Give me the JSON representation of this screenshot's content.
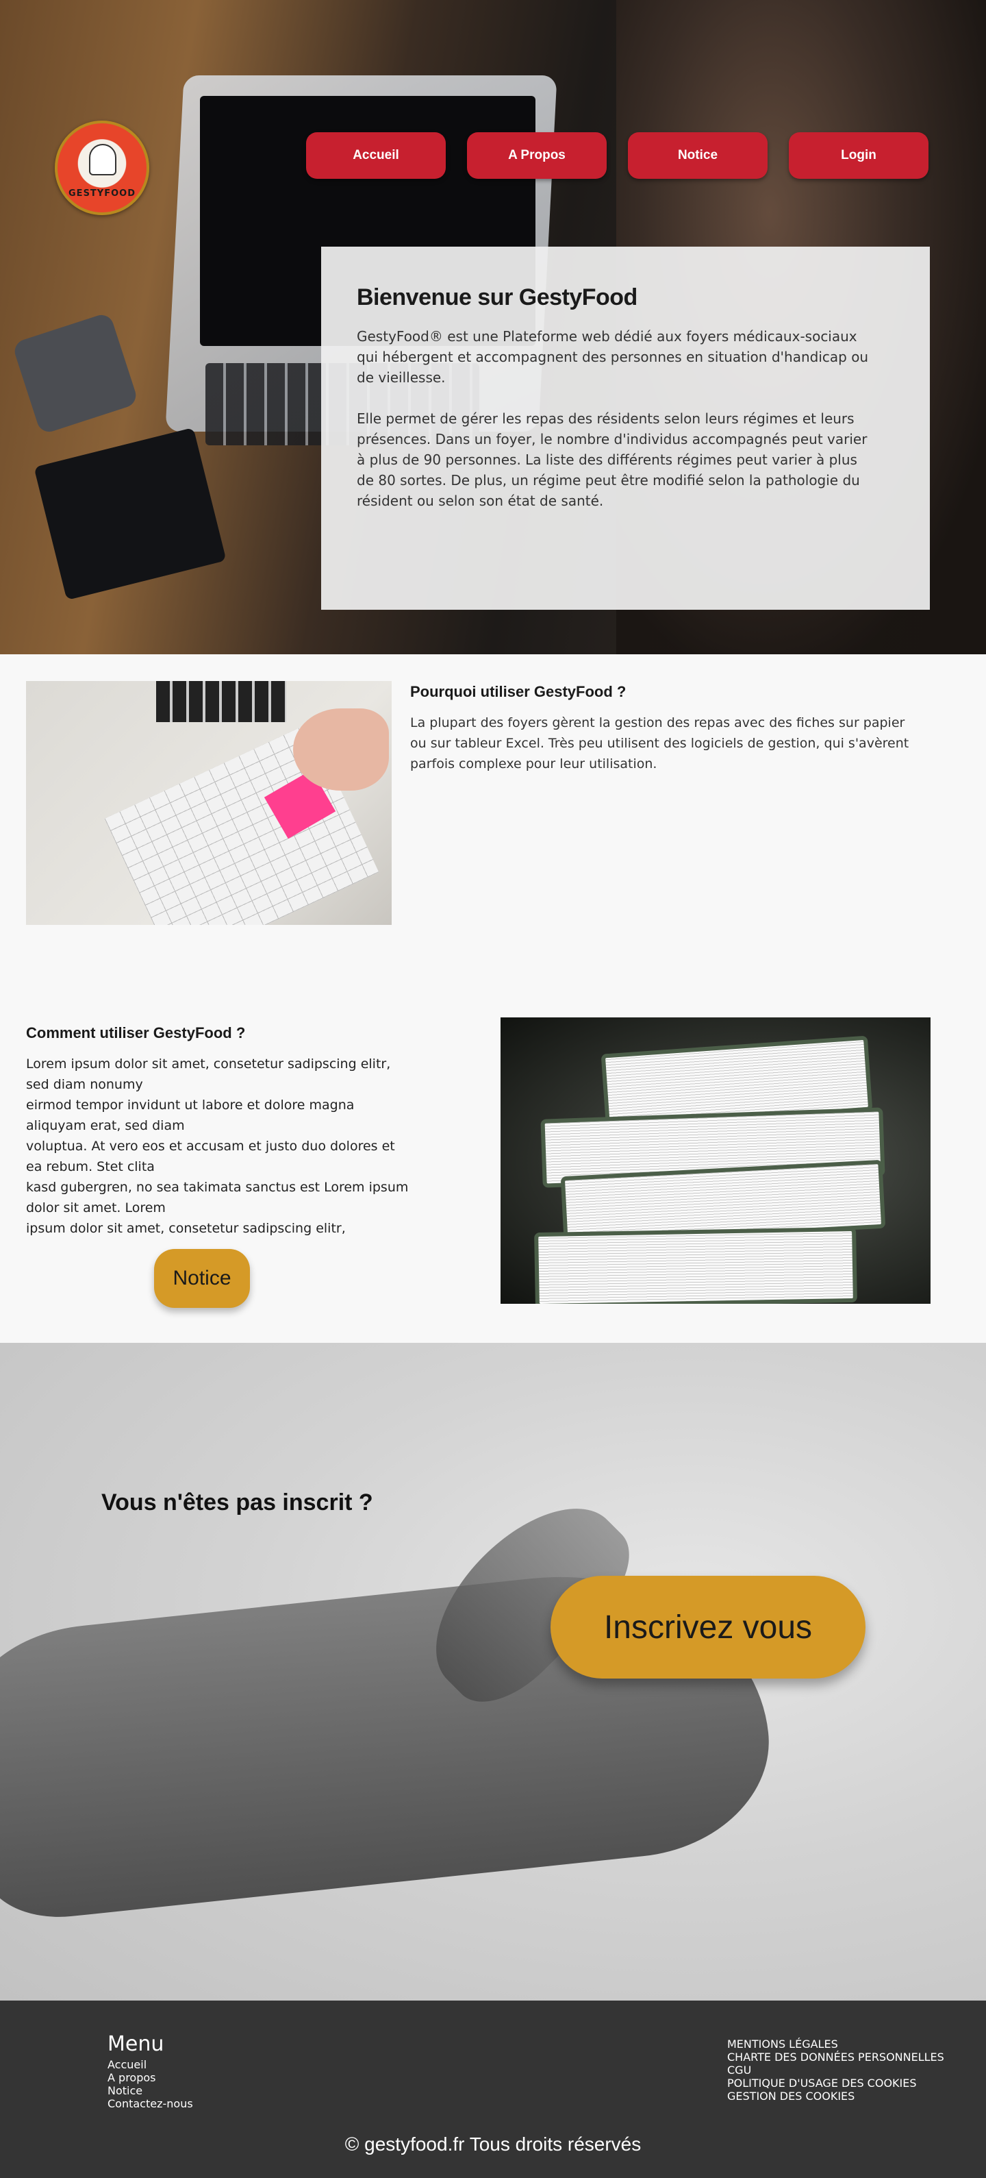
{
  "logo": {
    "text": "GESTYFOOD"
  },
  "nav": {
    "items": [
      "Accueil",
      "A Propos",
      "Notice",
      "Login"
    ]
  },
  "welcome": {
    "title": "Bienvenue sur GestyFood",
    "paragraph1": "GestyFood® est une Plateforme web dédié aux foyers médicaux-sociaux qui hébergent et accompagnent des personnes en situation d'handicap ou de vieillesse.",
    "paragraph2": "Elle permet de gérer les repas des résidents selon leurs régimes et leurs présences. Dans un foyer, le nombre d'individus accompagnés peut varier à plus de 90 personnes. La liste des différents régimes peut varier à plus de 80 sortes.  De plus, un régime peut être modifié selon la pathologie du résident ou selon son état de santé."
  },
  "why": {
    "title": "Pourquoi utiliser GestyFood ?",
    "text": "La plupart des foyers gèrent la gestion des repas avec des fiches sur papier ou sur tableur Excel. Très peu utilisent des logiciels  de gestion, qui s'avèrent parfois complexe pour leur utilisation."
  },
  "how": {
    "title": "Comment utiliser GestyFood ?",
    "text": "Lorem ipsum dolor sit amet, consetetur sadipscing elitr, sed diam nonumy\neirmod tempor invidunt ut labore et dolore magna aliquyam erat, sed diam\nvoluptua. At vero eos et accusam et justo duo dolores et ea rebum. Stet clita\nkasd gubergren, no sea takimata sanctus est Lorem ipsum dolor sit amet. Lorem\nipsum dolor sit amet, consetetur sadipscing elitr,",
    "button_label": "Notice"
  },
  "signup": {
    "title": "Vous n'êtes pas inscrit ?",
    "button_label": "Inscrivez vous"
  },
  "footer": {
    "menu_title": "Menu",
    "menu_items": [
      "Accueil",
      "A propos",
      "Notice",
      "Contactez-nous"
    ],
    "legal_items": [
      "MENTIONS LÉGALES",
      "CHARTE DES DONNÉES PERSONNELLES",
      "CGU",
      "POLITIQUE D'USAGE DES COOKIES",
      "GESTION DES COOKIES"
    ],
    "copyright": "© gestyfood.fr  Tous droits réservés"
  },
  "colors": {
    "nav_button": "#c7202f",
    "accent_button": "#d59a27",
    "divider": "#a5202a",
    "footer_bg": "#343434"
  }
}
